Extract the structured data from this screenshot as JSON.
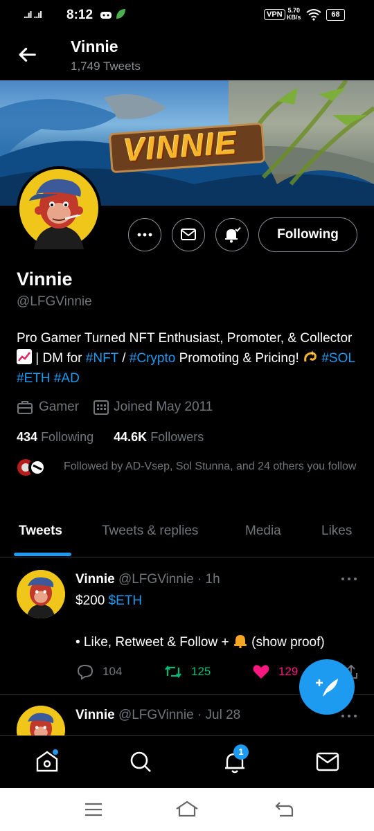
{
  "status_bar": {
    "time": "8:12",
    "signal": "..ıl ..ıl",
    "vpn": "VPN",
    "speed_value": "5.70",
    "speed_unit": "KB/s",
    "battery": "68"
  },
  "header": {
    "name": "Vinnie",
    "tweet_count": "1,749 Tweets"
  },
  "banner": {
    "logo_text": "VINNIE"
  },
  "profile": {
    "following_button": "Following",
    "name": "Vinnie",
    "handle": "@LFGVinnie",
    "bio": {
      "p1": "Pro Gamer Turned NFT Enthusiast, Promoter, & Collector ",
      "p2": " | DM for ",
      "tag_nft": "#NFT",
      "p3": " / ",
      "tag_crypto": "#Crypto",
      "p4": " Promoting & Pricing! ",
      "tag_sol": "#SOL",
      "tag_eth": "#ETH",
      "tag_ad": "#AD"
    },
    "category": "Gamer",
    "joined": "Joined May 2011",
    "following_count": "434",
    "following_label": "Following",
    "followers_count": "44.6K",
    "followers_label": "Followers",
    "followed_by": "Followed by AD-Vsep, Sol Stunna, and 24 others you follow"
  },
  "tabs": [
    {
      "label": "Tweets"
    },
    {
      "label": "Tweets & replies"
    },
    {
      "label": "Media"
    },
    {
      "label": "Likes"
    }
  ],
  "tweets": [
    {
      "name": "Vinnie",
      "handle_time": "@LFGVinnie · 1h",
      "line1_prefix": "$200 ",
      "line1_cashtag": "$ETH",
      "line2_prefix": "• Like, Retweet & Follow + ",
      "line2_suffix": " (show proof)",
      "replies": "104",
      "retweets": "125",
      "likes": "129"
    },
    {
      "name": "Vinnie",
      "handle_time": "@LFGVinnie · Jul 28"
    }
  ],
  "bottom_nav": {
    "notifications_badge": "1"
  },
  "colors": {
    "accent": "#1d9bf0",
    "retweet": "#00ba7c",
    "like": "#f91880",
    "background": "#000000",
    "muted": "#71767b"
  }
}
